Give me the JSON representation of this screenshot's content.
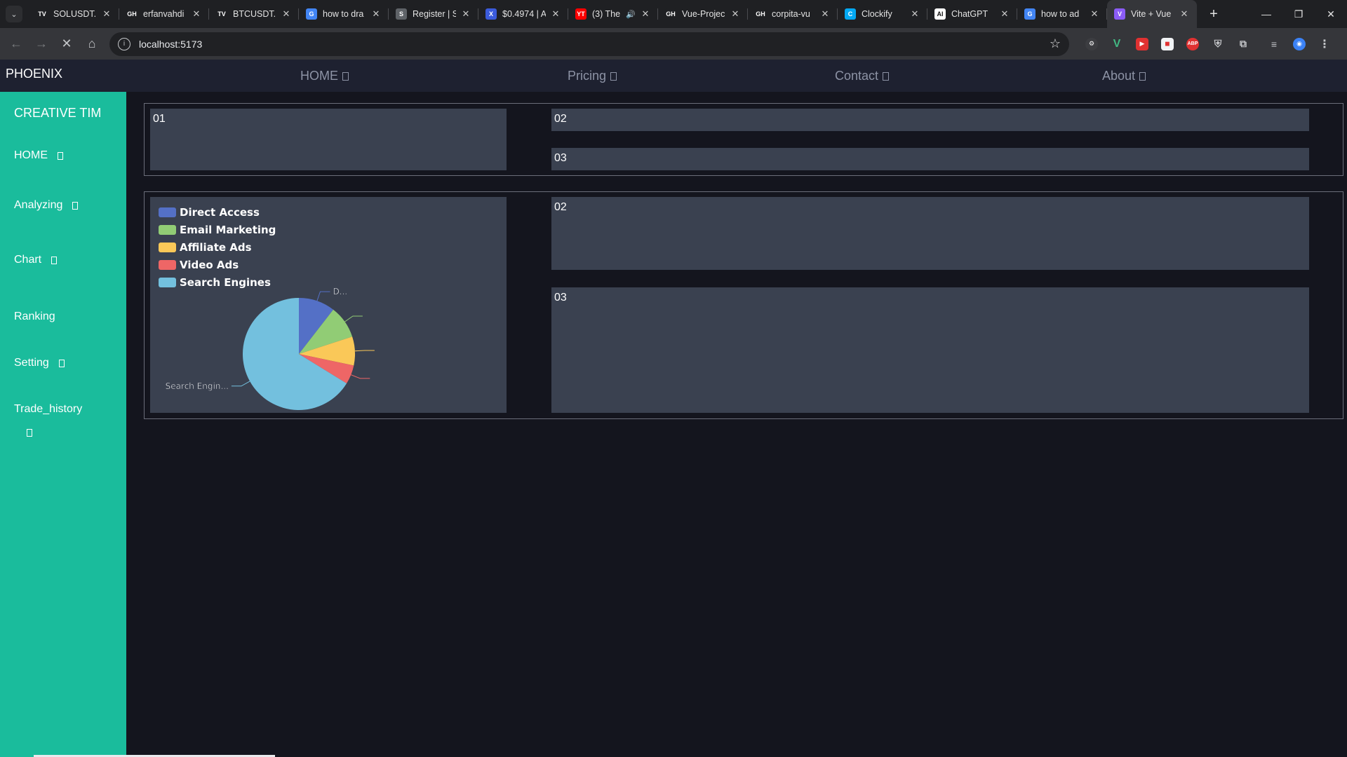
{
  "browser": {
    "tabs": [
      {
        "title": "SOLUSDT.P",
        "favicon": "TV",
        "color": "#1f2023",
        "active": false
      },
      {
        "title": "erfanvahdi",
        "favicon": "GH",
        "color": "#1f2023",
        "active": false
      },
      {
        "title": "BTCUSDT.P",
        "favicon": "TV",
        "color": "#1f2023",
        "active": false
      },
      {
        "title": "how to dra",
        "favicon": "G",
        "color": "#4285f4",
        "active": false
      },
      {
        "title": "Register | S",
        "favicon": "S",
        "color": "#5f6368",
        "active": false
      },
      {
        "title": "$0.4974 | A",
        "favicon": "X",
        "color": "#3b5bdb",
        "active": false
      },
      {
        "title": "(3) The",
        "favicon": "YT",
        "color": "#ff0000",
        "active": false,
        "audio": true
      },
      {
        "title": "Vue-Projec",
        "favicon": "GH",
        "color": "#1f2023",
        "active": false
      },
      {
        "title": "corpita-vu",
        "favicon": "GH",
        "color": "#1f2023",
        "active": false
      },
      {
        "title": "Clockify",
        "favicon": "C",
        "color": "#03a9f4",
        "active": false
      },
      {
        "title": "ChatGPT",
        "favicon": "AI",
        "color": "#ffffff",
        "active": false
      },
      {
        "title": "how to ad",
        "favicon": "G",
        "color": "#4285f4",
        "active": false
      },
      {
        "title": "Vite + Vue",
        "favicon": "V",
        "color": "#8b5cf6",
        "active": true
      }
    ],
    "url": "localhost:5173"
  },
  "app": {
    "brand": "PHOENIX",
    "nav": [
      {
        "label": "HOME"
      },
      {
        "label": "Pricing"
      },
      {
        "label": "Contact"
      },
      {
        "label": "About"
      }
    ],
    "sidebar_title": "CREATIVE TIM",
    "sidebar": [
      {
        "label": "HOME",
        "glyph": true
      },
      {
        "label": "Analyzing",
        "glyph": true
      },
      {
        "label": "Chart",
        "glyph": true
      },
      {
        "label": "Ranking",
        "glyph": false
      },
      {
        "label": "Setting",
        "glyph": true
      },
      {
        "label": "Trade_history",
        "glyph": true
      }
    ],
    "row1": {
      "card1": "01",
      "card2": "02",
      "card3": "03"
    },
    "row2": {
      "card2": "02",
      "card3": "03"
    }
  },
  "chart_data": {
    "type": "pie",
    "categories": [
      "Direct Access",
      "Email Marketing",
      "Affiliate Ads",
      "Video Ads",
      "Search Engines"
    ],
    "values": [
      10.5,
      9.5,
      8.3,
      5.5,
      66.2
    ],
    "colors": [
      "#5470c6",
      "#91cc75",
      "#fac858",
      "#ee6666",
      "#73c0de"
    ],
    "slice_labels": [
      "D...",
      "",
      "",
      "",
      "Search Engin..."
    ],
    "legend_position": "top-left"
  }
}
